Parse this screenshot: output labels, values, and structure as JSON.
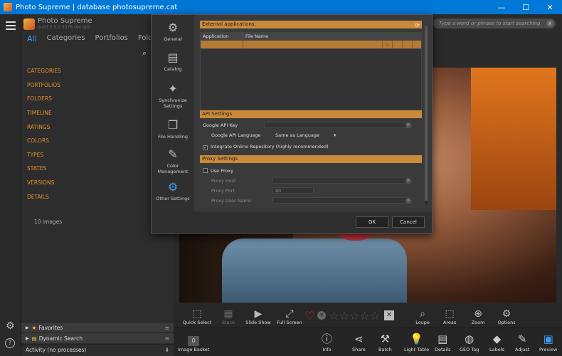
{
  "window": {
    "title": "Photo Supreme | database photosupreme.cat",
    "min": "—",
    "max": "☐",
    "close": "✕"
  },
  "brand": {
    "name": "Photo Supreme",
    "build": "build 5.5.0.3076 (64 bit)"
  },
  "nav_tabs": [
    "All",
    "Categories",
    "Portfolios",
    "Folders"
  ],
  "facets": [
    "CATEGORIES",
    "PORTFOLIOS",
    "FOLDERS",
    "TIMELINE",
    "RATINGS",
    "COLORS",
    "TYPES",
    "STATES",
    "VERSIONS",
    "DETAILS"
  ],
  "image_count": "10 images",
  "docks": {
    "favorites": "Favorites",
    "dynamic_search": "Dynamic Search",
    "activity": "Activity (no processes)"
  },
  "search": {
    "placeholder": "Type a word or phrase to start searching",
    "clear": "x"
  },
  "dialog": {
    "nav": [
      {
        "label": "General",
        "icon": "gear-icon"
      },
      {
        "label": "Catalog",
        "icon": "catalog-icon"
      },
      {
        "label": "Synchronize Settings",
        "icon": "sync-icon"
      },
      {
        "label": "File Handling",
        "icon": "file-icon"
      },
      {
        "label": "Color Management",
        "icon": "color-icon"
      },
      {
        "label": "Other Settings",
        "icon": "gears-icon"
      }
    ],
    "external_apps": {
      "header": "External applications:",
      "col_app": "Application",
      "col_file": "File Name"
    },
    "api": {
      "header": "API Settings",
      "key_label": "Google API Key",
      "lang_label": "Google API Language",
      "lang_value": "Same as Language",
      "integrate_label": "Integrate Online Repository (highly recommended)",
      "integrate_checked": true
    },
    "proxy": {
      "header": "Proxy Settings",
      "use_label": "Use Proxy",
      "host_label": "Proxy Host",
      "port_label": "Proxy Port",
      "port_value": "80",
      "user_label": "Proxy User Name"
    },
    "ok": "OK",
    "cancel": "Cancel"
  },
  "image_toolbar": {
    "quick_select": "Quick Select",
    "stack": "Stack",
    "slide_show": "Slide Show",
    "full_screen": "Full Screen",
    "loupe": "Loupe",
    "areas": "Areas",
    "zoom": "Zoom",
    "options": "Options",
    "rating_max": 5
  },
  "bottom_toolbar": {
    "image_basket": "Image Basket",
    "basket_count": "0",
    "buttons": [
      "Info",
      "Share",
      "Batch",
      "Light Table",
      "Details",
      "GEO Tag",
      "Labels",
      "Adjust",
      "Preview"
    ]
  },
  "colors": {
    "accent": "#3a9ef0",
    "facet": "#e0912a",
    "section_header": "#c98a3a"
  }
}
